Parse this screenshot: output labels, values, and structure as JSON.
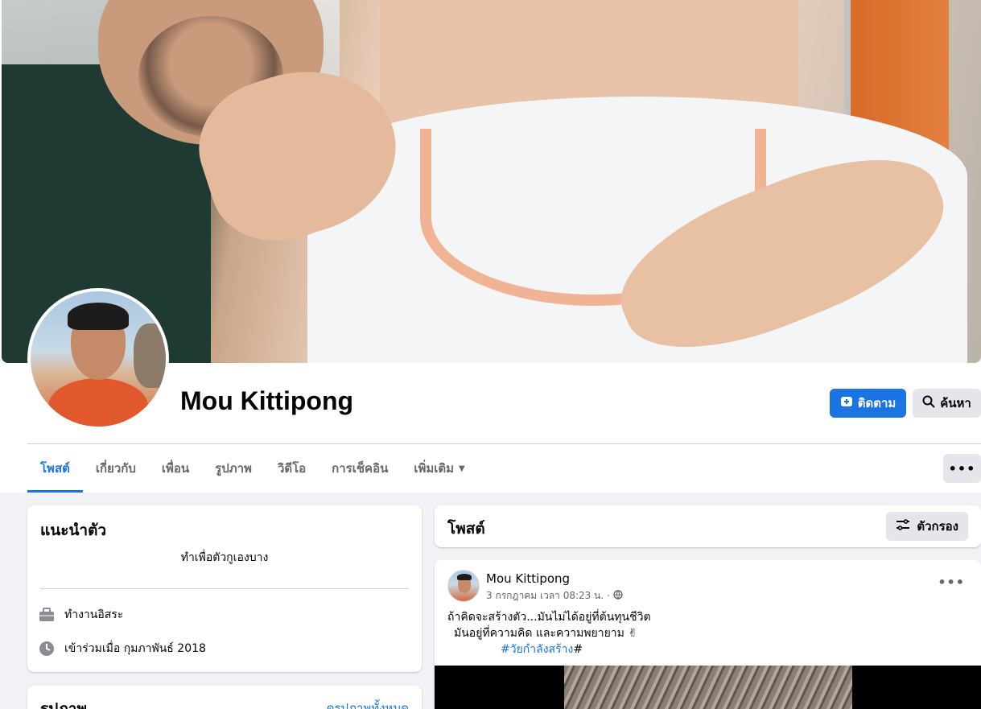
{
  "profile": {
    "name": "Mou Kittipong"
  },
  "actions": {
    "follow_label": "ติดตาม",
    "search_label": "ค้นหา",
    "more_label": "•••"
  },
  "tabs": [
    {
      "label": "โพสต์"
    },
    {
      "label": "เกี่ยวกับ"
    },
    {
      "label": "เพื่อน"
    },
    {
      "label": "รูปภาพ"
    },
    {
      "label": "วิดีโอ"
    },
    {
      "label": "การเช็คอิน"
    },
    {
      "label": "เพิ่มเติม"
    }
  ],
  "intro": {
    "title": "แนะนำตัว",
    "bio": "ทำเพื่อตัวกูเองบาง",
    "work": "ทำงานอิสระ",
    "joined": "เข้าร่วมเมื่อ กุมภาพันธ์ 2018"
  },
  "photos": {
    "title": "รูปภาพ",
    "see_all": "ดูรูปภาพทั้งหมด"
  },
  "posts_section": {
    "title": "โพสต์",
    "filter_label": "ตัวกรอง"
  },
  "post": {
    "author": "Mou Kittipong",
    "timestamp": "3 กรกฎาคม เวลา 08:23 น. ·",
    "line1": "ถ้าคิดจะสร้างตัว...มันไม่ได้อยู่ที่ต้นทุนชีวิต",
    "line2": "มันอยู่ที่ความคิด และความพยายาม ✌",
    "hashtag": "#วัยกำลังสร้าง",
    "hashtag_suffix": "#"
  },
  "colors": {
    "accent": "#1b74e4",
    "page_bg": "#f0f2f5",
    "secondary_button": "#e4e6eb"
  },
  "icons": {
    "follow": "follow-plus-icon",
    "search": "search-icon",
    "filter": "filter-icon",
    "work": "briefcase-icon",
    "joined": "clock-icon",
    "privacy": "globe-icon"
  }
}
